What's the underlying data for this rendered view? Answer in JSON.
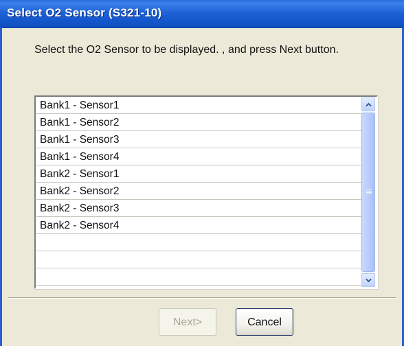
{
  "window": {
    "title": "Select O2 Sensor (S321-10)"
  },
  "instruction": "Select the O2 Sensor to be displayed. , and press Next button.",
  "sensor_list": {
    "items": [
      "Bank1 - Sensor1",
      "Bank1 - Sensor2",
      "Bank1 - Sensor3",
      "Bank1 - Sensor4",
      "Bank2 - Sensor1",
      "Bank2 - Sensor2",
      "Bank2 - Sensor3",
      "Bank2 - Sensor4",
      "",
      "",
      ""
    ]
  },
  "buttons": {
    "next_label": "Next>",
    "next_enabled": false,
    "cancel_label": "Cancel"
  },
  "colors": {
    "titlebar": "#1f63d6",
    "dialog_face": "#ece9d8",
    "scrollbar_thumb": "#b6cbfa",
    "disabled_text": "#aaa89a"
  },
  "icons": {
    "scroll_up": "chevron-up-icon",
    "scroll_down": "chevron-down-icon"
  }
}
